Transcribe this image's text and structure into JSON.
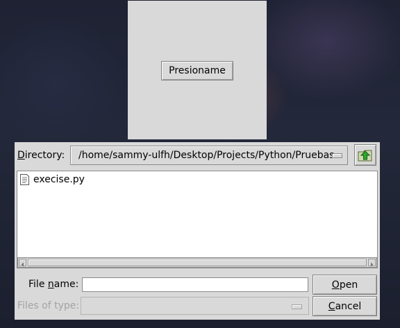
{
  "main_window": {
    "button_label": "Presioname"
  },
  "file_dialog": {
    "directory_label_underlined": "D",
    "directory_label_rest": "irectory:",
    "directory_path": "/home/sammy-ulfh/Desktop/Projects/Python/Pruebas",
    "up_icon": "folder-up-icon",
    "files": [
      {
        "name": "execise.py",
        "icon": "document-icon"
      }
    ],
    "file_name_label_pre": "File ",
    "file_name_label_underlined": "n",
    "file_name_label_post": "ame:",
    "file_name_value": "",
    "open_underlined": "O",
    "open_rest": "pen",
    "files_of_type_label": "Files of type:",
    "files_of_type_value": "",
    "cancel_underlined": "C",
    "cancel_rest": "ancel"
  }
}
